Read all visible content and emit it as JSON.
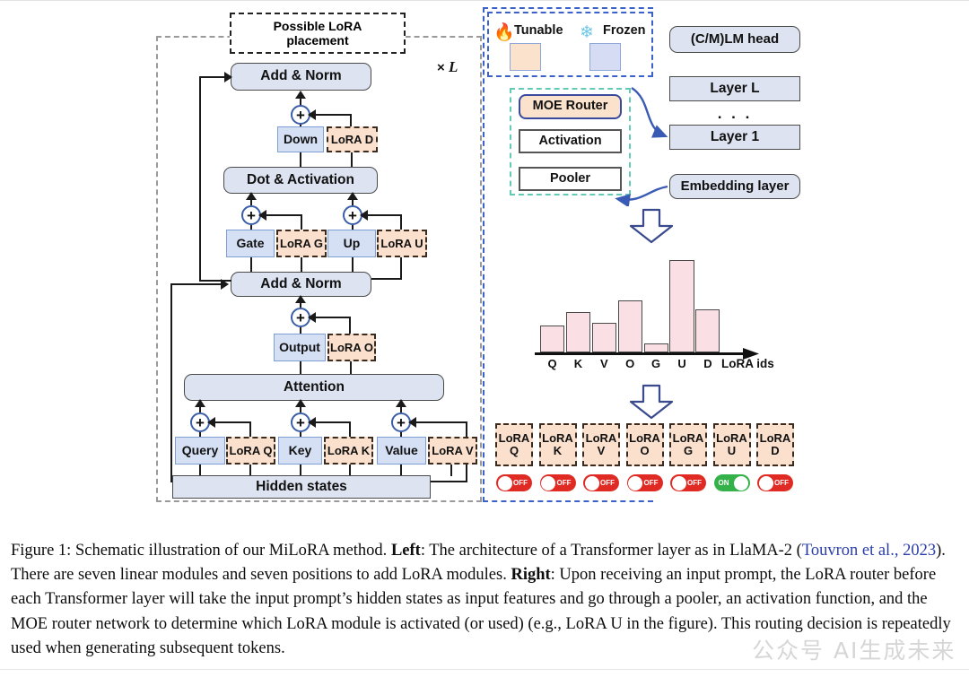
{
  "figure": {
    "left_panel": {
      "possible_lora_placement": "Possible LoRA\nplacement",
      "repeat_label": "× L",
      "blocks": {
        "add_norm_top": "Add & Norm",
        "down": "Down",
        "lora_d": "LoRA D",
        "dot_activation": "Dot & Activation",
        "gate": "Gate",
        "lora_g": "LoRA G",
        "up": "Up",
        "lora_u": "LoRA U",
        "add_norm_mid": "Add & Norm",
        "output": "Output",
        "lora_o": "LoRA O",
        "attention": "Attention",
        "query": "Query",
        "lora_q": "LoRA Q",
        "key": "Key",
        "lora_k": "LoRA K",
        "value": "Value",
        "lora_v": "LoRA V",
        "hidden_states": "Hidden states"
      }
    },
    "legend": {
      "tunable_label": "Tunable",
      "frozen_label": "Frozen",
      "tunable_icon": "fire-icon",
      "frozen_icon": "snowflake-icon",
      "tunable_color": "#fae2cd",
      "frozen_color": "#d6dcf3"
    },
    "router": {
      "moe_router": "MOE Router",
      "activation": "Activation",
      "pooler": "Pooler"
    },
    "model_stack": {
      "lm_head": "(C/M)LM head",
      "layer_l": "Layer L",
      "ellipsis": ". . .",
      "layer_1": "Layer 1",
      "embedding": "Embedding layer"
    },
    "lora_modules": [
      {
        "name": "LoRA",
        "id": "Q",
        "state": "OFF"
      },
      {
        "name": "LoRA",
        "id": "K",
        "state": "OFF"
      },
      {
        "name": "LoRA",
        "id": "V",
        "state": "OFF"
      },
      {
        "name": "LoRA",
        "id": "O",
        "state": "OFF"
      },
      {
        "name": "LoRA",
        "id": "G",
        "state": "OFF"
      },
      {
        "name": "LoRA",
        "id": "U",
        "state": "ON"
      },
      {
        "name": "LoRA",
        "id": "D",
        "state": "OFF"
      }
    ]
  },
  "chart_data": {
    "type": "bar",
    "title": "",
    "xlabel": "LoRA ids",
    "ylabel": "",
    "categories": [
      "Q",
      "K",
      "V",
      "O",
      "G",
      "U",
      "D"
    ],
    "values": [
      29,
      44,
      32,
      57,
      10,
      101,
      47
    ],
    "ylim": [
      0,
      110
    ],
    "grid": false,
    "legend": "none",
    "bar_color": "#fadfe4",
    "bar_edge_color": "#4a4a4a",
    "axis_label_x": "LoRA ids"
  },
  "caption": {
    "figure_number": "Figure 1:",
    "part1": " Schematic illustration of our MiLoRA method. ",
    "left_bold": "Left",
    "part2": ": The architecture of a Transformer layer as in LlaMA-2 (",
    "citation": "Touvron et al., 2023",
    "part3": "). There are seven linear modules and seven positions to add LoRA modules. ",
    "right_bold": "Right",
    "part4": ": Upon receiving an input prompt, the LoRA router before each Transformer layer will take the input prompt’s hidden states as input features and go through a pooler, an activation function, and the MOE router network to determine which LoRA module is activated (or used) (e.g., LoRA U in the figure). This routing decision is repeatedly used when generating subsequent tokens.",
    "watermark": "公众号  AI生成未来"
  }
}
